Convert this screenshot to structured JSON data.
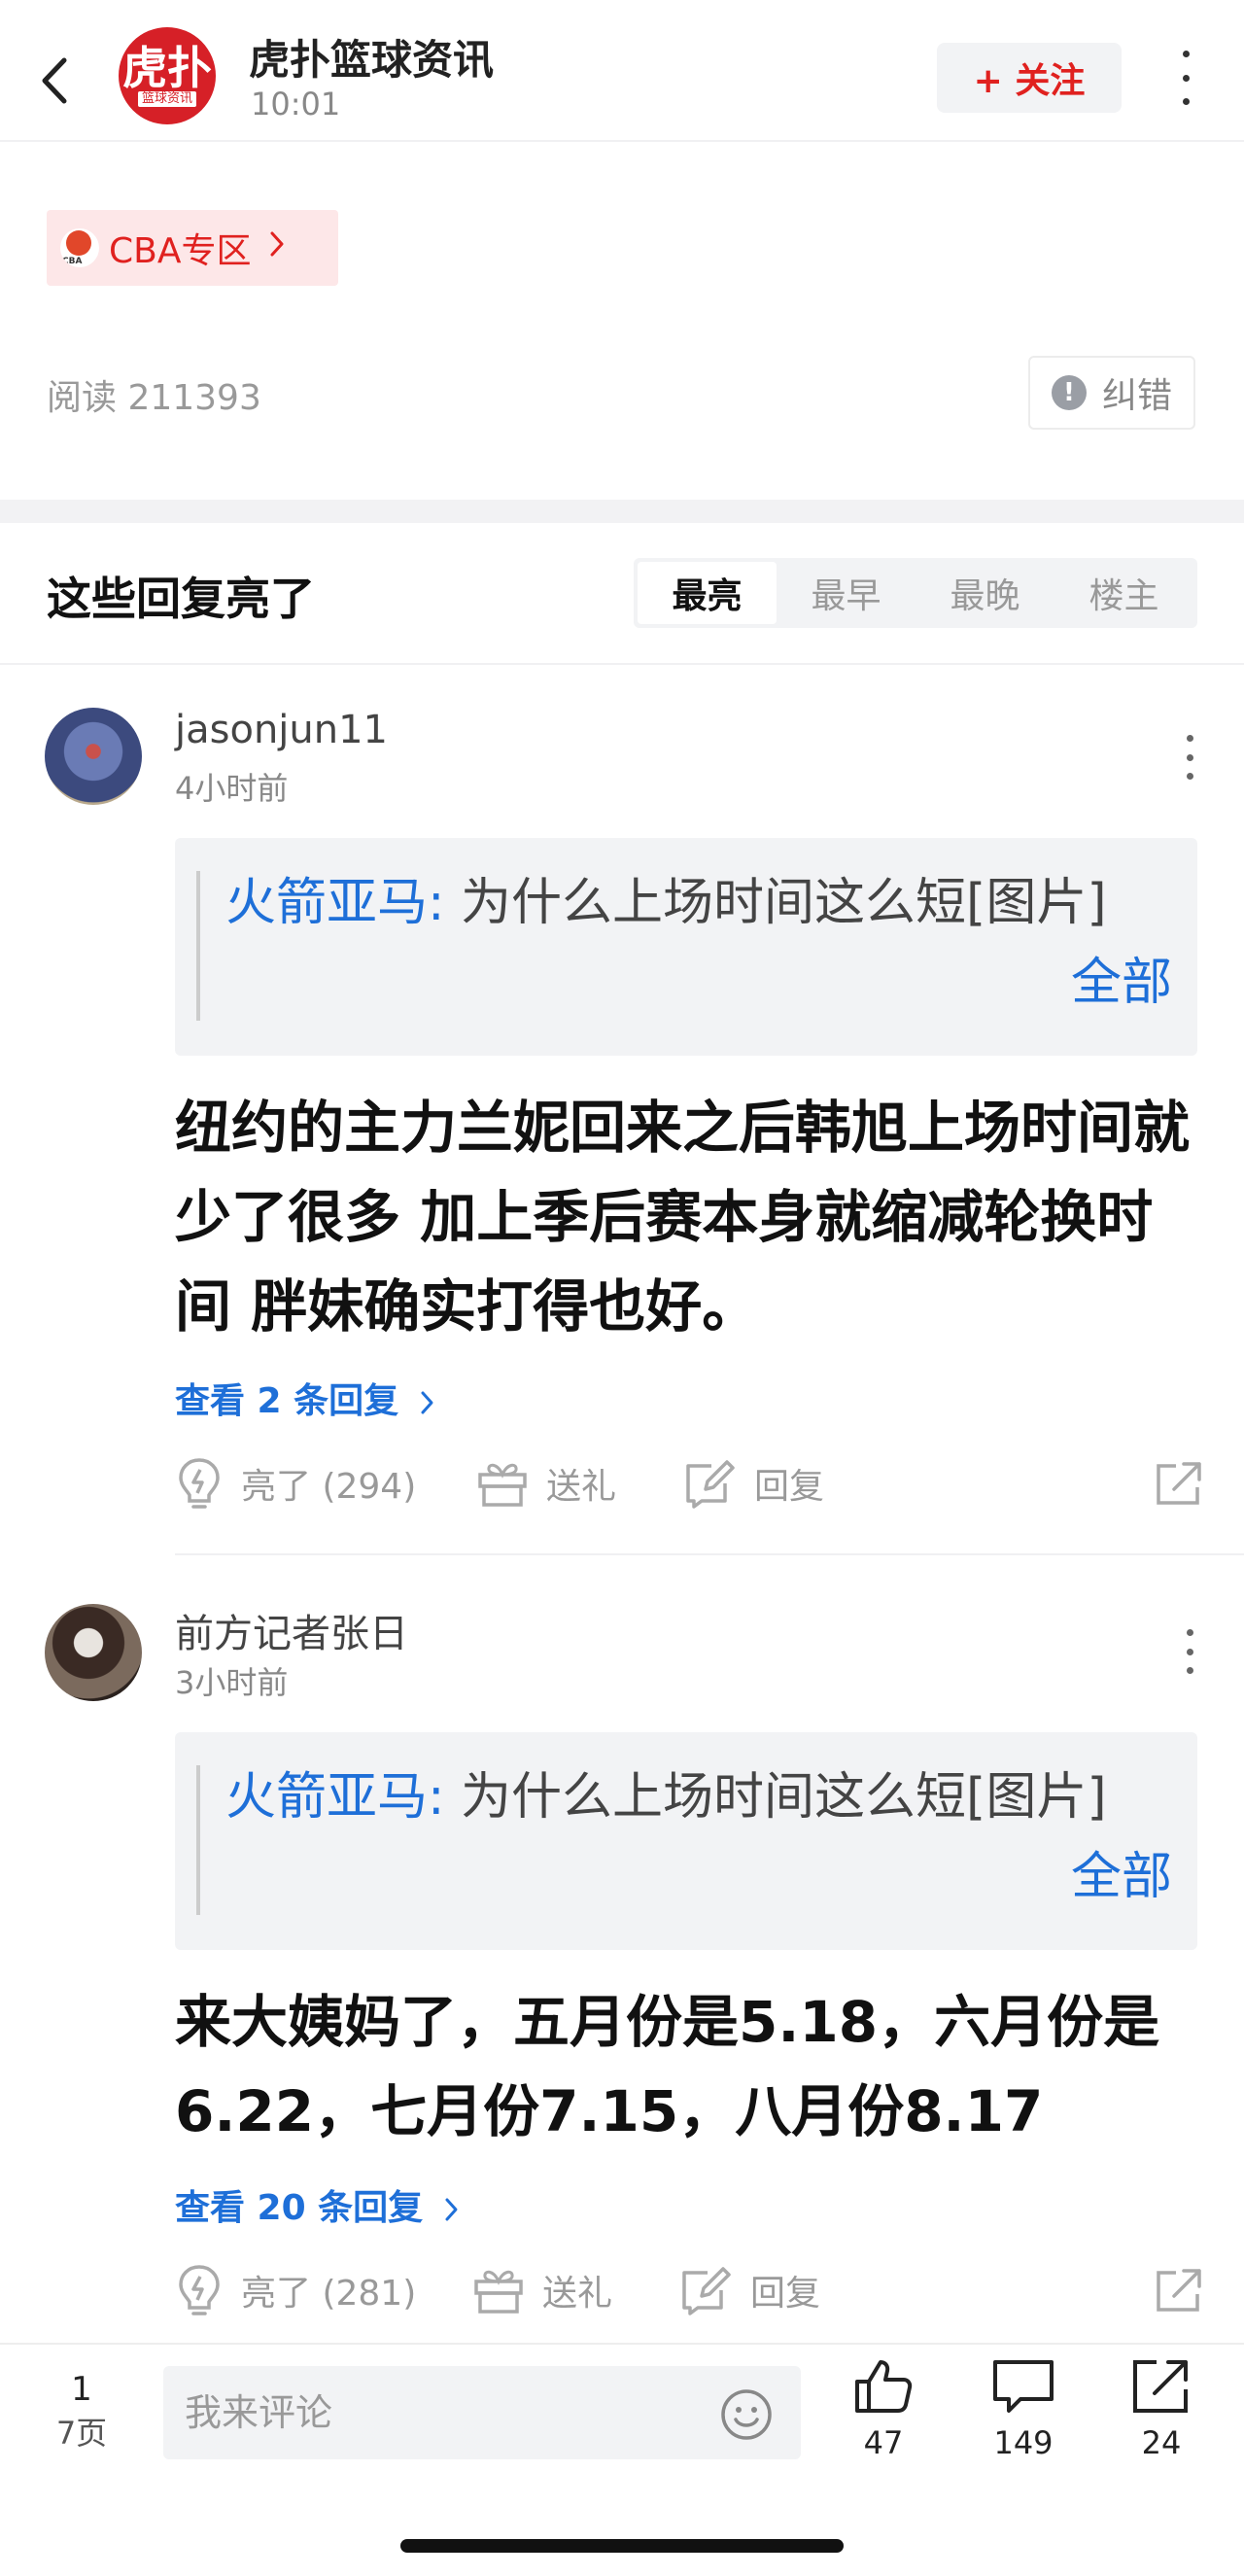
{
  "header": {
    "source_name": "虎扑篮球资讯",
    "time": "10:01",
    "logo_big": "虎扑",
    "logo_small": "篮球资讯",
    "follow_label": "+ 关注"
  },
  "tag": {
    "label": "CBA专区",
    "icon_text": "CBA"
  },
  "stats": {
    "read_label": "阅读 211393",
    "correct_label": "纠错"
  },
  "section": {
    "title": "这些回复亮了",
    "tabs": [
      "最亮",
      "最早",
      "最晚",
      "楼主"
    ],
    "active_tab": "最亮"
  },
  "comments": [
    {
      "user": "jasonjun11",
      "time": "4小时前",
      "quote_author": "火箭亚马:",
      "quote_text": " 为什么上场时间这么短[图片]",
      "quote_all": "全部",
      "body": "纽约的主力兰妮回来之后韩旭上场时间就少了很多 加上季后赛本身就缩减轮换时间 胖妹确实打得也好。",
      "replies": "查看 2 条回复",
      "light": "亮了 (294)",
      "gift": "送礼",
      "reply": "回复"
    },
    {
      "user": "前方记者张日",
      "time": "3小时前",
      "quote_author": "火箭亚马:",
      "quote_text": " 为什么上场时间这么短[图片]",
      "quote_all": "全部",
      "body": "来大姨妈了，五月份是5.18，六月份是6.22，七月份7.15，八月份8.17",
      "replies": "查看 20 条回复",
      "light": "亮了 (281)",
      "gift": "送礼",
      "reply": "回复"
    }
  ],
  "bottom": {
    "page_current": "1",
    "page_total": "7页",
    "comment_placeholder": "我来评论",
    "likes": "47",
    "comments": "149",
    "shares": "24"
  },
  "colors": {
    "accent_red": "#e0211f",
    "link_blue": "#1e6fd8"
  }
}
